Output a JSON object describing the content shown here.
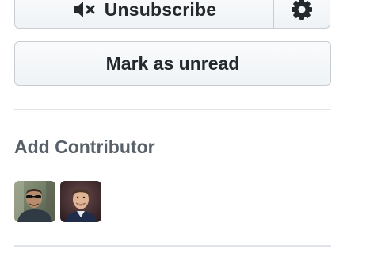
{
  "notifications": {
    "unsubscribe_label": "Unsubscribe",
    "mute_icon": "speaker-muted-icon",
    "settings_icon": "gear-icon",
    "mark_unread_label": "Mark as unread"
  },
  "contributors": {
    "title": "Add Contributor",
    "avatars": [
      {
        "icon": "avatar-photo-sunglasses"
      },
      {
        "icon": "avatar-photo-smiling"
      }
    ]
  },
  "colors": {
    "button_border": "#c8cdd3",
    "divider": "#e1e4e8",
    "heading": "#586069",
    "text": "#24292e"
  }
}
